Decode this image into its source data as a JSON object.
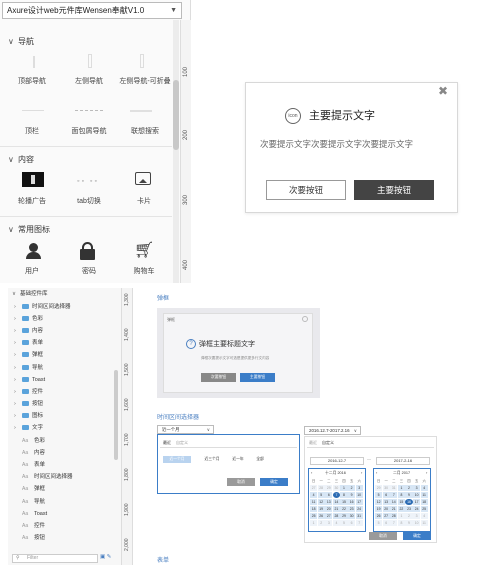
{
  "library": {
    "dropdown_value": "Axure设计web元件库Wensen奉献V1.0",
    "sections": [
      {
        "title": "导航",
        "items": [
          "顶部导航",
          "左侧导航",
          "左侧导航-可折叠",
          "顶栏",
          "面包屑导航",
          "联想搜索"
        ]
      },
      {
        "title": "内容",
        "items": [
          "轮播广告",
          "tab切换",
          "卡片"
        ]
      },
      {
        "title": "常用图标",
        "items": [
          "用户",
          "密码",
          "购物车"
        ]
      }
    ],
    "ruler_marks": [
      "100",
      "200",
      "300",
      "400"
    ]
  },
  "modal": {
    "icon_text": "icon",
    "title": "主要提示文字",
    "subtitle": "次要提示文字次要提示文字次要提示文字",
    "secondary_button": "次要按钮",
    "primary_button": "主要按钮",
    "close_glyph": "✖"
  },
  "tree": {
    "root": "基础控件库",
    "folders": [
      "时间区间选择器",
      "色彩",
      "内容",
      "表单",
      "弹框",
      "导航",
      "Toast",
      "控件",
      "按钮",
      "图标",
      "文字"
    ],
    "pages": [
      "色彩",
      "内容",
      "表单",
      "时间区间选择器",
      "弹框",
      "导航",
      "Toast",
      "控件",
      "按钮"
    ],
    "search_placeholder": "Filter",
    "ruler_marks": [
      "1,300",
      "1,400",
      "1,500",
      "1,600",
      "1,700",
      "1,800",
      "1,900",
      "2,000"
    ]
  },
  "canvas": {
    "dialog_section": "弹框",
    "dialog": {
      "name": "弹框",
      "title": "弹框主要标题文字",
      "subtitle": "弹框次要提示文字可选是提供更多行文内容",
      "secondary_button": "次要按钮",
      "primary_button": "主要按钮"
    },
    "range_section": "时间区间选择器",
    "range_select": "近一个月",
    "range_tabs": [
      "最近",
      "自定义"
    ],
    "range_chips": [
      "近一个月",
      "近三个月",
      "近一年",
      "全部"
    ],
    "range_cancel": "取消",
    "range_ok": "确定",
    "cal_select": "2016.12.7-2017.2.16",
    "cal_tabs": [
      "最近",
      "自定义"
    ],
    "cal_start_input": "2016-12-7",
    "cal_end_input": "2017-2-16",
    "cal_separator": "—",
    "cal_left": {
      "title": "十二月 2016",
      "weekdays": [
        "日",
        "一",
        "二",
        "三",
        "四",
        "五",
        "六"
      ]
    },
    "cal_right": {
      "title": "二月 2017",
      "weekdays": [
        "日",
        "一",
        "二",
        "三",
        "四",
        "五",
        "六"
      ]
    },
    "cal_cancel": "取消",
    "cal_ok": "确定",
    "table_section": "表单"
  }
}
